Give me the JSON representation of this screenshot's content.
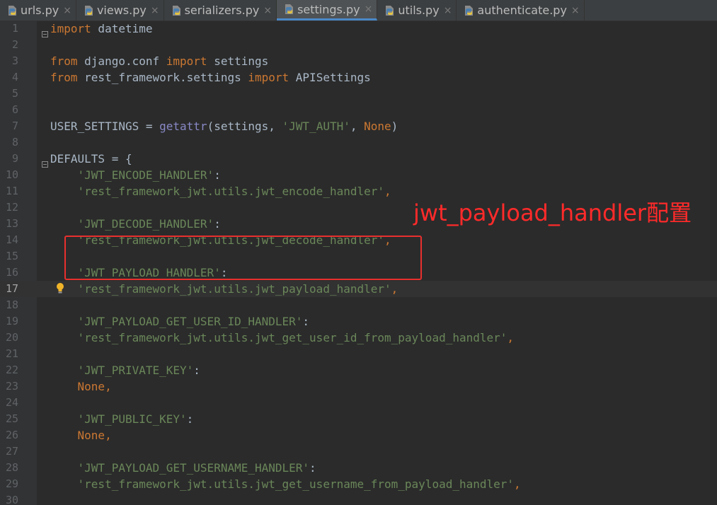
{
  "tabs": [
    {
      "label": "urls.py",
      "active": false
    },
    {
      "label": "views.py",
      "active": false
    },
    {
      "label": "serializers.py",
      "active": false
    },
    {
      "label": "settings.py",
      "active": true
    },
    {
      "label": "utils.py",
      "active": false
    },
    {
      "label": "authenticate.py",
      "active": false
    }
  ],
  "tab_close_glyph": "×",
  "current_line": 17,
  "lines": [
    {
      "n": "1",
      "tokens": [
        [
          "kw",
          "import"
        ],
        [
          "p",
          " datetime"
        ]
      ]
    },
    {
      "n": "2",
      "tokens": []
    },
    {
      "n": "3",
      "tokens": [
        [
          "kw",
          "from"
        ],
        [
          "p",
          " django.conf "
        ],
        [
          "kw",
          "import"
        ],
        [
          "p",
          " settings"
        ]
      ]
    },
    {
      "n": "4",
      "tokens": [
        [
          "kw",
          "from"
        ],
        [
          "p",
          " rest_framework.settings "
        ],
        [
          "kw",
          "import"
        ],
        [
          "p",
          " APISettings"
        ]
      ]
    },
    {
      "n": "5",
      "tokens": []
    },
    {
      "n": "6",
      "tokens": []
    },
    {
      "n": "7",
      "tokens": [
        [
          "p",
          "USER_SETTINGS = "
        ],
        [
          "builtin",
          "getattr"
        ],
        [
          "p",
          "(settings, "
        ],
        [
          "str",
          "'JWT_AUTH'"
        ],
        [
          "p",
          ", "
        ],
        [
          "kw",
          "None"
        ],
        [
          "p",
          ")"
        ]
      ]
    },
    {
      "n": "8",
      "tokens": []
    },
    {
      "n": "9",
      "tokens": [
        [
          "p",
          "DEFAULTS = {"
        ]
      ]
    },
    {
      "n": "10",
      "tokens": [
        [
          "p",
          "    "
        ],
        [
          "str",
          "'JWT_ENCODE_HANDLER'"
        ],
        [
          "p",
          ":"
        ]
      ]
    },
    {
      "n": "11",
      "tokens": [
        [
          "p",
          "    "
        ],
        [
          "str",
          "'rest_framework_jwt.utils.jwt_encode_handler'"
        ],
        [
          "kw",
          ","
        ]
      ]
    },
    {
      "n": "12",
      "tokens": []
    },
    {
      "n": "13",
      "tokens": [
        [
          "p",
          "    "
        ],
        [
          "str",
          "'JWT_DECODE_HANDLER'"
        ],
        [
          "p",
          ":"
        ]
      ]
    },
    {
      "n": "14",
      "tokens": [
        [
          "p",
          "    "
        ],
        [
          "str",
          "'rest_framework_jwt.utils.jwt_decode_handler'"
        ],
        [
          "kw",
          ","
        ]
      ]
    },
    {
      "n": "15",
      "tokens": []
    },
    {
      "n": "16",
      "tokens": [
        [
          "p",
          "    "
        ],
        [
          "str",
          "'JWT_PAYLOAD_HANDLER'"
        ],
        [
          "p",
          ":"
        ]
      ]
    },
    {
      "n": "17",
      "tokens": [
        [
          "p",
          "    "
        ],
        [
          "str",
          "'rest_framework_jwt.utils.jwt_payload_handler'"
        ],
        [
          "kw",
          ","
        ]
      ]
    },
    {
      "n": "18",
      "tokens": []
    },
    {
      "n": "19",
      "tokens": [
        [
          "p",
          "    "
        ],
        [
          "str",
          "'JWT_PAYLOAD_GET_USER_ID_HANDLER'"
        ],
        [
          "p",
          ":"
        ]
      ]
    },
    {
      "n": "20",
      "tokens": [
        [
          "p",
          "    "
        ],
        [
          "str",
          "'rest_framework_jwt.utils.jwt_get_user_id_from_payload_handler'"
        ],
        [
          "kw",
          ","
        ]
      ]
    },
    {
      "n": "21",
      "tokens": []
    },
    {
      "n": "22",
      "tokens": [
        [
          "p",
          "    "
        ],
        [
          "str",
          "'JWT_PRIVATE_KEY'"
        ],
        [
          "p",
          ":"
        ]
      ]
    },
    {
      "n": "23",
      "tokens": [
        [
          "p",
          "    "
        ],
        [
          "kw",
          "None,"
        ]
      ]
    },
    {
      "n": "24",
      "tokens": []
    },
    {
      "n": "25",
      "tokens": [
        [
          "p",
          "    "
        ],
        [
          "str",
          "'JWT_PUBLIC_KEY'"
        ],
        [
          "p",
          ":"
        ]
      ]
    },
    {
      "n": "26",
      "tokens": [
        [
          "p",
          "    "
        ],
        [
          "kw",
          "None,"
        ]
      ]
    },
    {
      "n": "27",
      "tokens": []
    },
    {
      "n": "28",
      "tokens": [
        [
          "p",
          "    "
        ],
        [
          "str",
          "'JWT_PAYLOAD_GET_USERNAME_HANDLER'"
        ],
        [
          "p",
          ":"
        ]
      ]
    },
    {
      "n": "29",
      "tokens": [
        [
          "p",
          "    "
        ],
        [
          "str",
          "'rest_framework_jwt.utils.jwt_get_username_from_payload_handler'"
        ],
        [
          "kw",
          ","
        ]
      ]
    },
    {
      "n": "30",
      "tokens": []
    }
  ],
  "fold_marker_lines": [
    1,
    9
  ],
  "bulb_line": 17,
  "annotation": {
    "text": "jwt_payload_handler配置",
    "color": "#ff2a2a"
  },
  "colors": {
    "background": "#2b2b2b",
    "gutter": "#313335",
    "keyword": "#cc7832",
    "string": "#6a8759",
    "builtin": "#8888c6",
    "text": "#a9b7c6",
    "line_number": "#606366",
    "active_tab_underline": "#4a88c7",
    "highlight_box": "#e8302e"
  },
  "icons": {
    "tab_file_icon": "python-file-icon",
    "bulb_icon": "lightbulb-icon",
    "fold_icon": "fold-marker-icon"
  }
}
